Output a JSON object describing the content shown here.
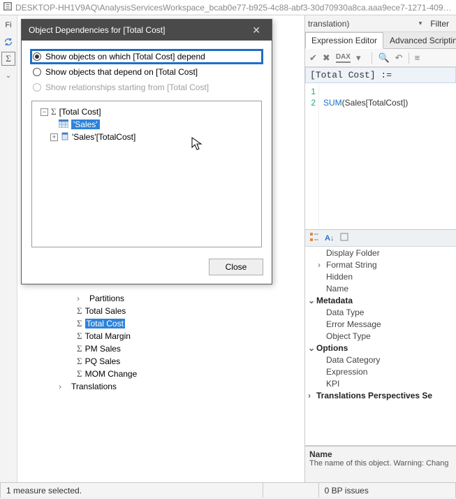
{
  "titlebar": {
    "path": "DESKTOP-HH1V9AQ\\AnalysisServicesWorkspace_bcab0e77-b925-4c88-abf3-30d70930a8ca.aaa9ece7-1271-409…"
  },
  "dialog": {
    "title": "Object Dependencies for [Total Cost]",
    "radio1": "Show objects on which [Total Cost] depend",
    "radio2": "Show objects that depend on [Total Cost]",
    "radio3": "Show relationships starting from [Total Cost]",
    "tree": {
      "root": "[Total Cost]",
      "child1": "'Sales'",
      "child2": "'Sales'[TotalCost]"
    },
    "close": "Close"
  },
  "left_tree": {
    "partitions": "Partitions",
    "measures": [
      "Total Sales",
      "Total Cost",
      "Total Margin",
      "PM Sales",
      "PQ Sales",
      "MOM Change"
    ],
    "translations": "Translations"
  },
  "right": {
    "translation_hint": "translation)",
    "filter": "Filter",
    "tabs": {
      "expr": "Expression Editor",
      "adv": "Advanced Scripting"
    },
    "toolbar": {
      "dax": "DAX"
    },
    "expr_header": "[Total Cost] :=",
    "gutter": [
      "1",
      "2"
    ],
    "code_fn": "SUM",
    "code_args": "(Sales[TotalCost])"
  },
  "properties": {
    "items": [
      {
        "label": "Display Folder",
        "group": false,
        "exp": ""
      },
      {
        "label": "Format String",
        "group": false,
        "exp": "›"
      },
      {
        "label": "Hidden",
        "group": false,
        "exp": ""
      },
      {
        "label": "Name",
        "group": false,
        "exp": ""
      },
      {
        "label": "Metadata",
        "group": true,
        "exp": "⌄"
      },
      {
        "label": "Data Type",
        "group": false,
        "exp": ""
      },
      {
        "label": "Error Message",
        "group": false,
        "exp": ""
      },
      {
        "label": "Object Type",
        "group": false,
        "exp": ""
      },
      {
        "label": "Options",
        "group": true,
        "exp": "⌄"
      },
      {
        "label": "Data Category",
        "group": false,
        "exp": ""
      },
      {
        "label": "Expression",
        "group": false,
        "exp": ""
      },
      {
        "label": "KPI",
        "group": false,
        "exp": ""
      },
      {
        "label": "Translations  Perspectives  Se",
        "group": true,
        "exp": "›"
      }
    ],
    "footer_name": "Name",
    "footer_desc": "The name of this object. Warning: Chang"
  },
  "statusbar": {
    "left": "1 measure selected.",
    "right": "0 BP issues"
  }
}
